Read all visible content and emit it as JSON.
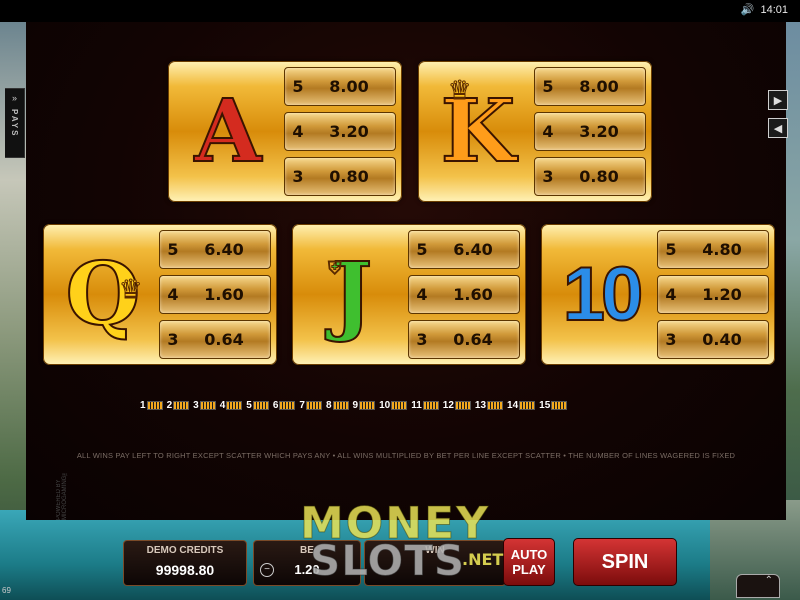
{
  "status": {
    "speaker_icon": "speaker-icon",
    "time": "14:01"
  },
  "side": {
    "pays_label": "PAYS",
    "next_icon": "play-right-icon",
    "prev_icon": "play-left-icon"
  },
  "paytable": [
    {
      "symbol": "A",
      "color": "#d42b1f",
      "pays": [
        {
          "count": "5",
          "value": "8.00"
        },
        {
          "count": "4",
          "value": "3.20"
        },
        {
          "count": "3",
          "value": "0.80"
        }
      ]
    },
    {
      "symbol": "K",
      "color": "#ff9c1a",
      "pays": [
        {
          "count": "5",
          "value": "8.00"
        },
        {
          "count": "4",
          "value": "3.20"
        },
        {
          "count": "3",
          "value": "0.80"
        }
      ]
    },
    {
      "symbol": "Q",
      "color": "#ffd11a",
      "pays": [
        {
          "count": "5",
          "value": "6.40"
        },
        {
          "count": "4",
          "value": "1.60"
        },
        {
          "count": "3",
          "value": "0.64"
        }
      ]
    },
    {
      "symbol": "J",
      "color": "#3fbf2f",
      "pays": [
        {
          "count": "5",
          "value": "6.40"
        },
        {
          "count": "4",
          "value": "1.60"
        },
        {
          "count": "3",
          "value": "0.64"
        }
      ]
    },
    {
      "symbol": "10",
      "color": "#2b8de8",
      "pays": [
        {
          "count": "5",
          "value": "4.80"
        },
        {
          "count": "4",
          "value": "1.20"
        },
        {
          "count": "3",
          "value": "0.40"
        }
      ]
    }
  ],
  "paylines": [
    "1",
    "2",
    "3",
    "4",
    "5",
    "6",
    "7",
    "8",
    "9",
    "10",
    "11",
    "12",
    "13",
    "14",
    "15"
  ],
  "rules": "ALL WINS PAY LEFT TO RIGHT EXCEPT SCATTER WHICH PAYS ANY  •  ALL WINS MULTIPLIED BY BET PER LINE EXCEPT SCATTER  •  THE NUMBER OF LINES WAGERED IS FIXED",
  "brand_vertical": "POWERED BY MICROGAMING™",
  "bottom": {
    "credits_label": "DEMO CREDITS",
    "credits_value": "99998.80",
    "bet_label": "BE",
    "bet_value": "1.20",
    "win_label": "WIN",
    "autoplay_label": "AUTO PLAY",
    "spin_label": "SPIN",
    "left_note": "69"
  },
  "watermark": {
    "line1": "MONEY",
    "line2": "SLOTS",
    "suffix": ".NET"
  }
}
